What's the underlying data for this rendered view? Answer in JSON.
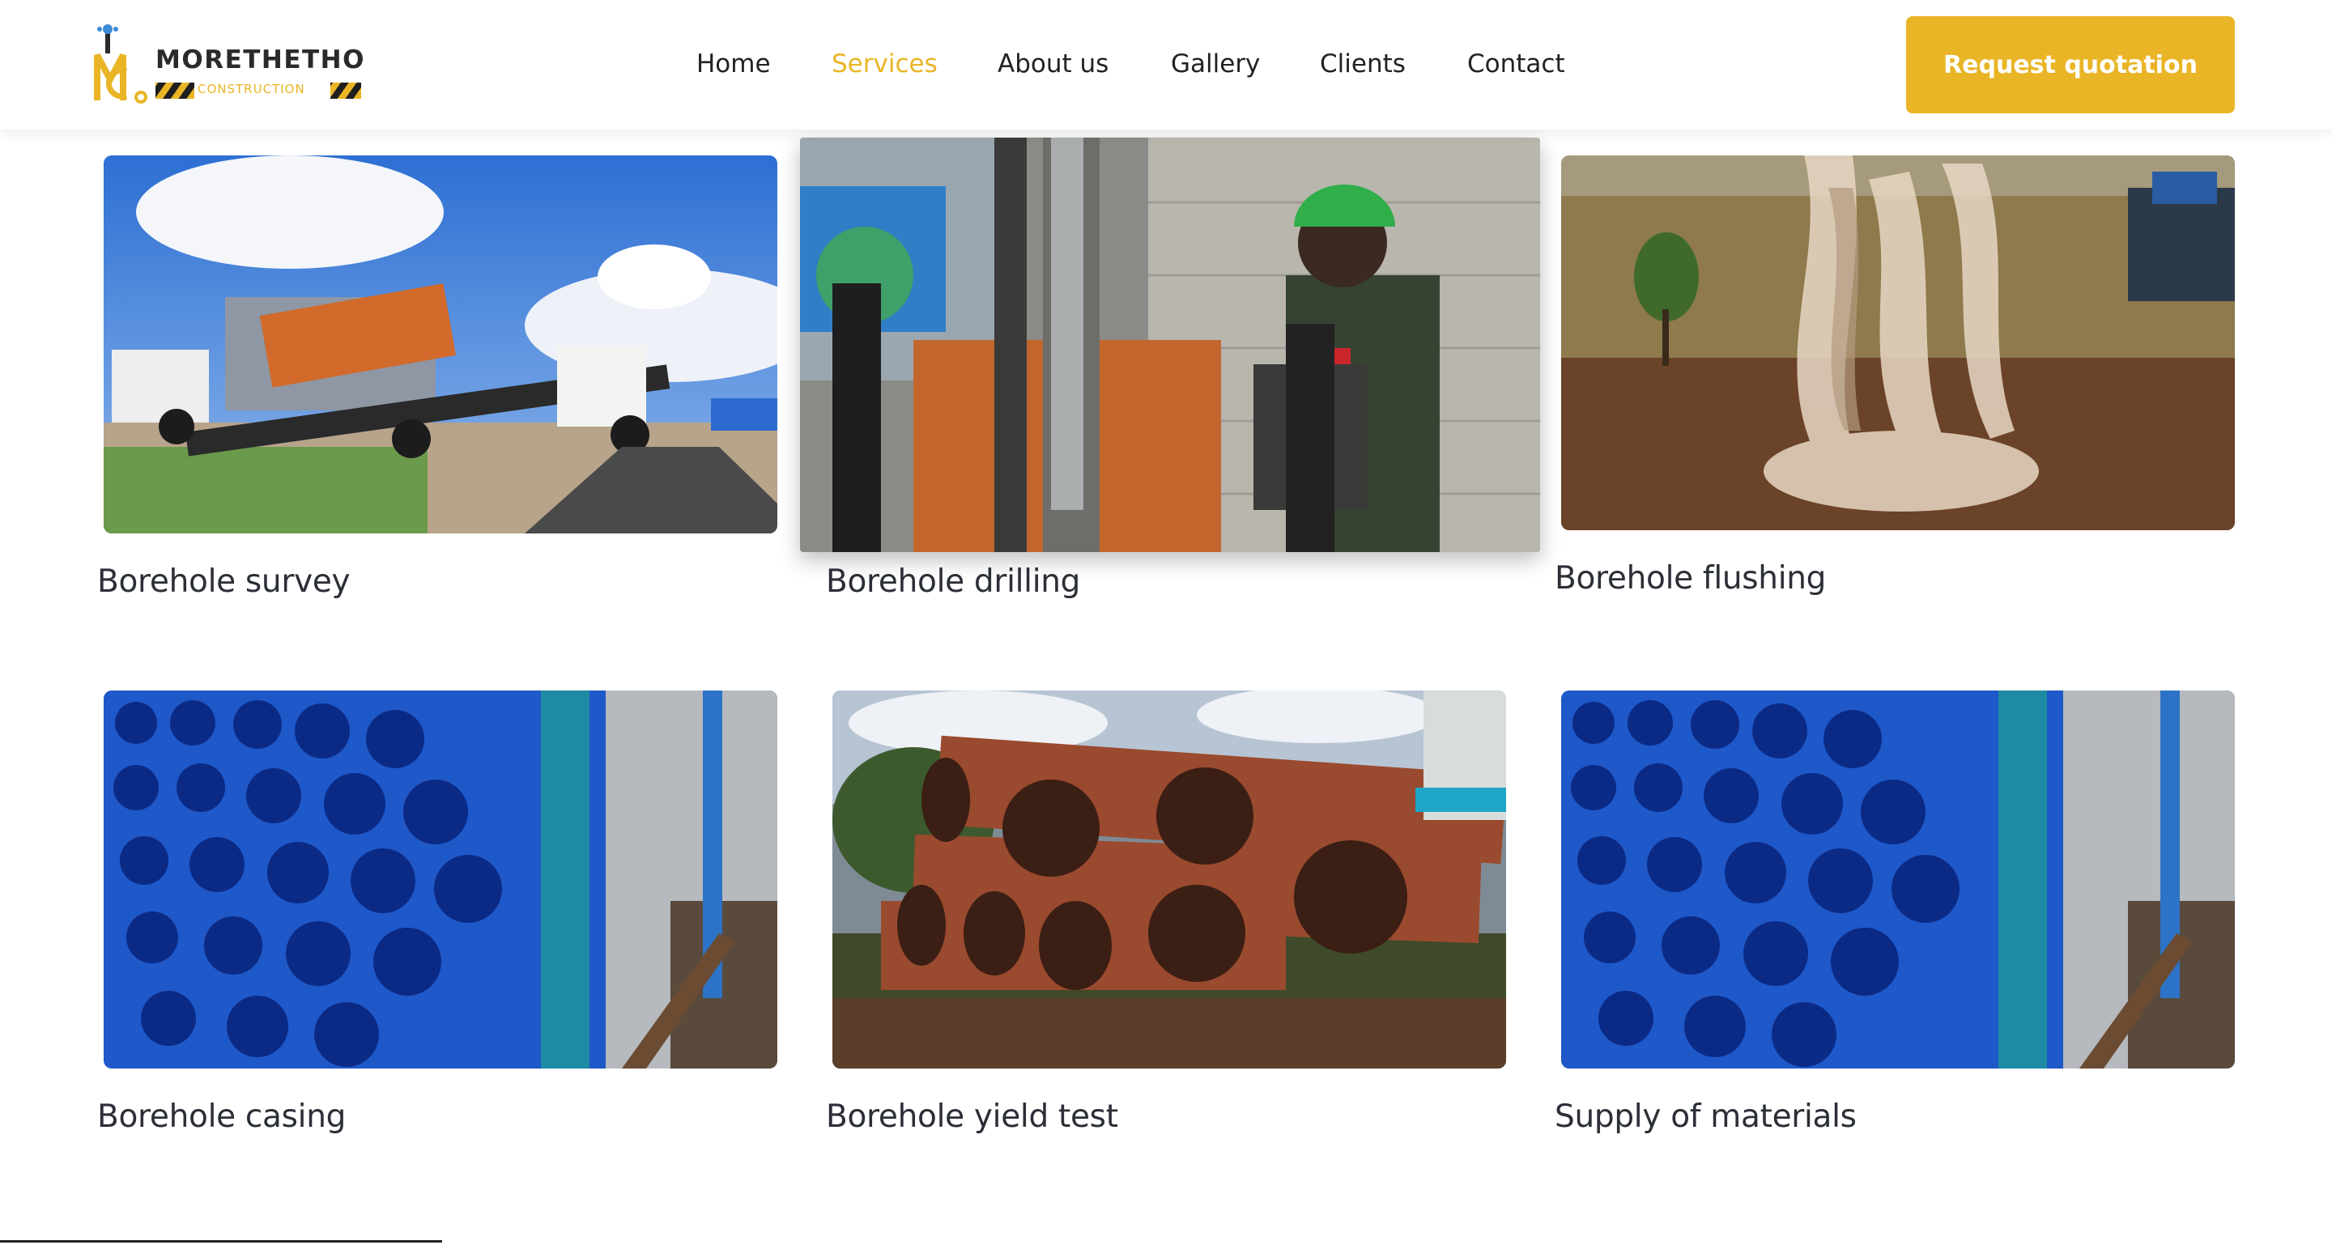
{
  "brand": {
    "name": "MORETHETHO",
    "tagline": "CONSTRUCTION",
    "primary_color": "#e9b526",
    "dark_color": "#1f1f1f"
  },
  "nav": {
    "items": [
      {
        "label": "Home"
      },
      {
        "label": "Services",
        "active": true
      },
      {
        "label": "About us"
      },
      {
        "label": "Gallery"
      },
      {
        "label": "Clients"
      },
      {
        "label": "Contact"
      }
    ],
    "cta_label": "Request quotation"
  },
  "services": [
    {
      "title": "Borehole survey",
      "image": "drilling-truck-photo"
    },
    {
      "title": "Borehole drilling",
      "image": "drilling-worker-photo"
    },
    {
      "title": "Borehole flushing",
      "image": "water-flushing-photo"
    },
    {
      "title": "Borehole casing",
      "image": "blue-pvc-pipes-photo"
    },
    {
      "title": "Borehole yield test",
      "image": "rusty-steel-pipes-photo"
    },
    {
      "title": "Supply of materials",
      "image": "blue-pvc-pipes-photo"
    }
  ]
}
